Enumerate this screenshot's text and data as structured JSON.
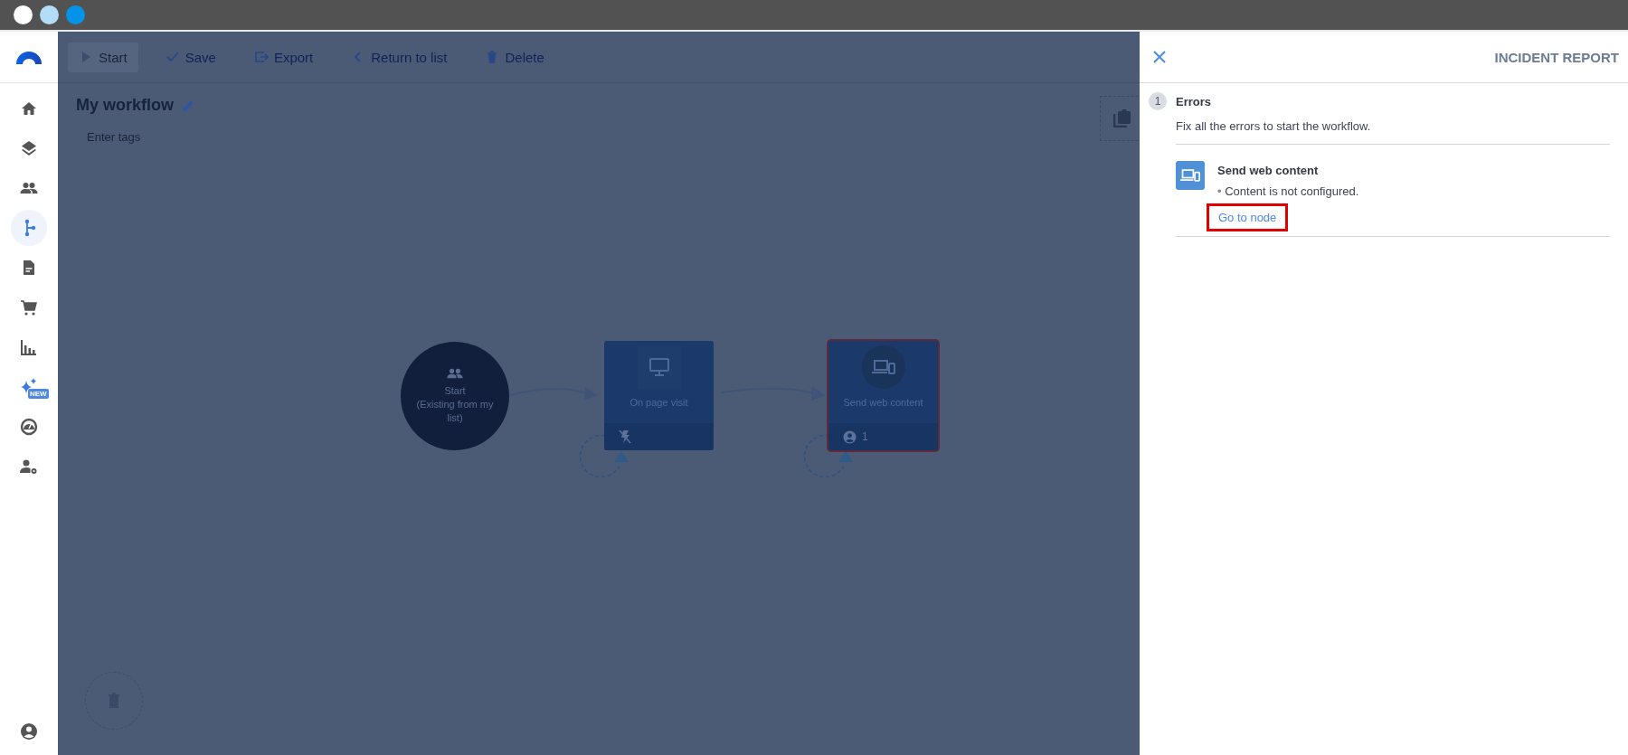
{
  "window_controls": [
    {
      "color": "#ffffff"
    },
    {
      "color": "#b3dcf7"
    },
    {
      "color": "#0593ea"
    }
  ],
  "sidebar": {
    "items": [
      {
        "selected": false
      },
      {
        "selected": false
      },
      {
        "selected": false
      },
      {
        "selected": true
      },
      {
        "selected": false
      },
      {
        "selected": false
      },
      {
        "selected": false
      },
      {
        "selected": false,
        "badge": "NEW"
      },
      {
        "selected": false
      },
      {
        "selected": false
      }
    ]
  },
  "toolbar": [
    {
      "label": "Start",
      "disabled": true
    },
    {
      "label": "Save",
      "disabled": false
    },
    {
      "label": "Export",
      "disabled": false
    },
    {
      "label": "Return to list",
      "disabled": false
    },
    {
      "label": "Delete",
      "disabled": false
    }
  ],
  "workflow": {
    "title": "My workflow",
    "tags_placeholder": "Enter tags",
    "nodes": [
      {
        "kind": "start",
        "label": "Start",
        "sublabel": "(Existing from my list)"
      },
      {
        "kind": "trigger",
        "label": "On page visit",
        "error": false
      },
      {
        "kind": "action",
        "label": "Send web content",
        "error": true,
        "count": "1"
      }
    ]
  },
  "panel": {
    "title": "INCIDENT REPORT",
    "sections": [
      {
        "count": "1",
        "heading": "Errors",
        "description": "Fix all the errors to start the workflow.",
        "items": [
          {
            "title": "Send web content",
            "bullet": "•",
            "messages": [
              "Content is not configured."
            ],
            "link": {
              "label": "Go to node",
              "highlighted": true
            }
          }
        ]
      }
    ]
  }
}
